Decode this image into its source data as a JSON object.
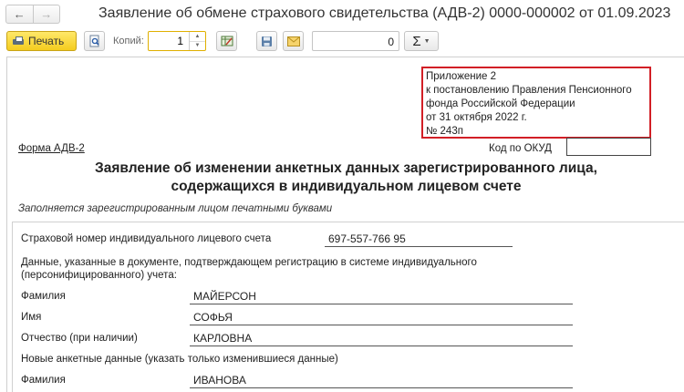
{
  "window": {
    "title": "Заявление об обмене страхового свидетельства (АДВ-2) 0000-000002 от 01.09.2023",
    "nav_back": "←",
    "nav_forward": "→"
  },
  "toolbar": {
    "print_label": "Печать",
    "copies_label": "Копий:",
    "copies_value": "1",
    "count_value": "0",
    "sum_label": "Σ",
    "sum_dropdown": "▼"
  },
  "document": {
    "appendix": [
      "Приложение 2",
      "к постановлению Правления Пенсионного",
      "фонда Российской Федерации",
      "от 31 октября 2022 г.",
      "№ 243п"
    ],
    "form_name": "Форма АДВ-2",
    "okud_label": "Код по ОКУД",
    "title_line1": "Заявление об изменении анкетных данных зарегистрированного лица,",
    "title_line2": "содержащихся в индивидуальном лицевом счете",
    "hint": "Заполняется зарегистрированным лицом печатными буквами",
    "fields": {
      "snils_label": "Страховой номер индивидуального лицевого счета",
      "snils_value": "697-557-766 95",
      "reg_doc_line1": "Данные, указанные в документе, подтверждающем регистрацию в системе индивидуального",
      "reg_doc_line2": "(персонифицированного) учета:",
      "surname_label": "Фамилия",
      "surname_value": "МАЙЕРСОН",
      "name_label": "Имя",
      "name_value": "СОФЬЯ",
      "patronymic_label": "Отчество (при наличии)",
      "patronymic_value": "КАРЛОВНА",
      "new_data_label": "Новые анкетные данные (указать только изменившиеся данные)",
      "new_surname_label": "Фамилия",
      "new_surname_value": "ИВАНОВА"
    }
  }
}
